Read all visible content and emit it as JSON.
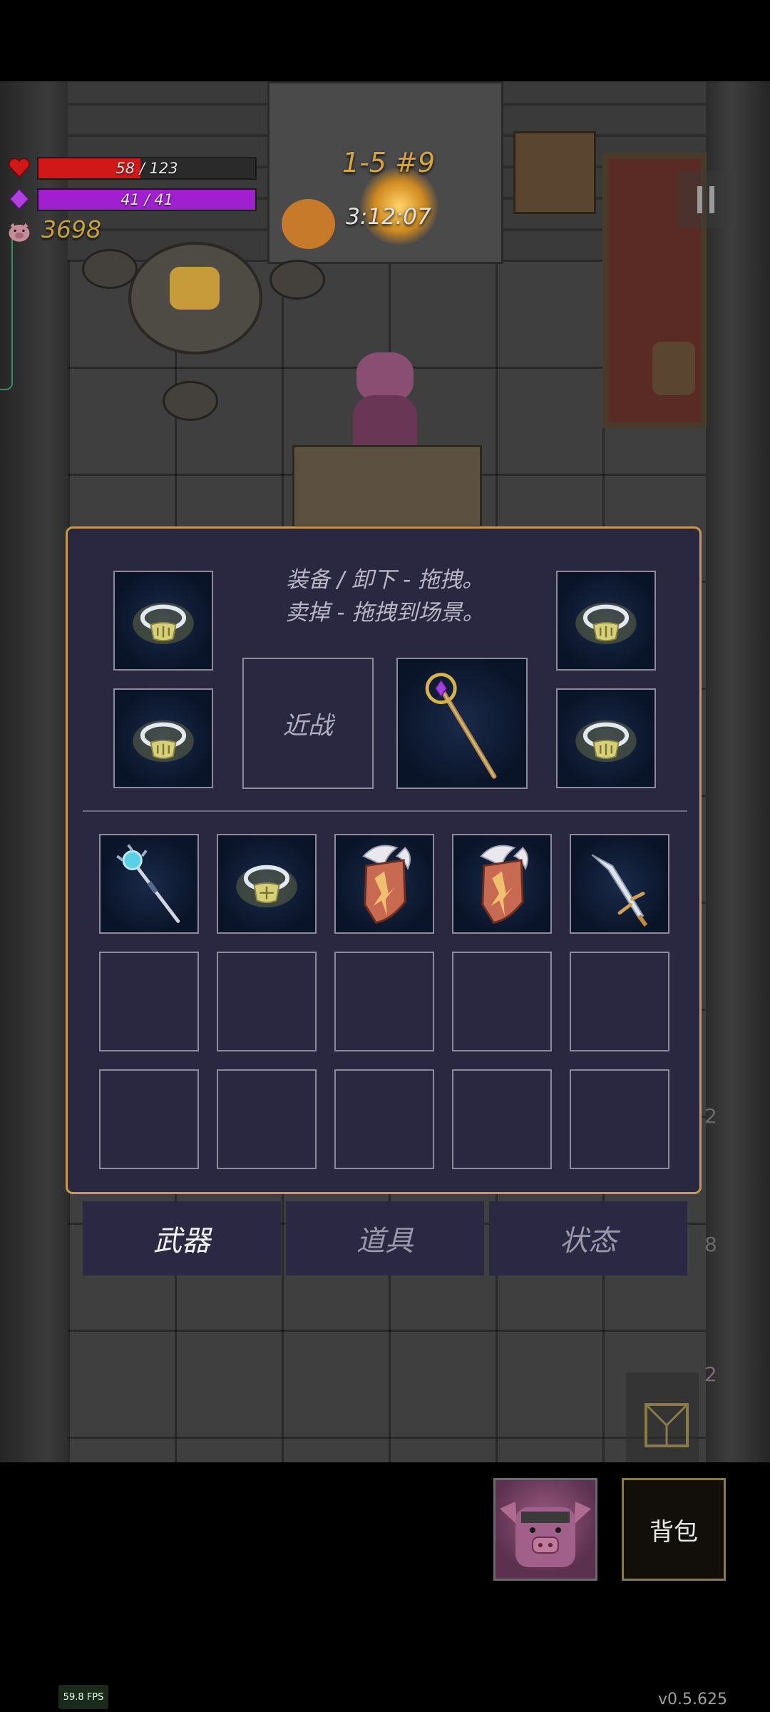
{
  "hud": {
    "hp": {
      "label": "58 / 123",
      "value": 58,
      "max": 123,
      "color": "#d01818"
    },
    "mp": {
      "label": "41 / 41",
      "value": 41,
      "max": 41,
      "color": "#a020d0"
    },
    "gold": "3698",
    "level": "1-5 #9",
    "timer": "3:12:07"
  },
  "panel": {
    "hint_line1": "装备 / 卸下 - 拖拽。",
    "hint_line2": "卖掉 - 拖拽到场景。",
    "melee_slot_label": "近战",
    "equipped_icons": [
      "ring-icon",
      "ring-icon",
      "ring-icon",
      "ring-icon",
      "staff-icon"
    ],
    "inventory_row1": [
      "mace-icon",
      "ring-icon",
      "winged-shield-icon",
      "winged-shield-icon",
      "spear-icon"
    ]
  },
  "tabs": [
    {
      "label": "武器",
      "active": true
    },
    {
      "label": "道具",
      "active": false
    },
    {
      "label": "状态",
      "active": false
    }
  ],
  "side": {
    "num1": "2",
    "num2": "8",
    "num3": "2"
  },
  "bottom": {
    "bag_label": "背包"
  },
  "footer": {
    "fps": "59.8 FPS",
    "version": "v0.5.625"
  }
}
